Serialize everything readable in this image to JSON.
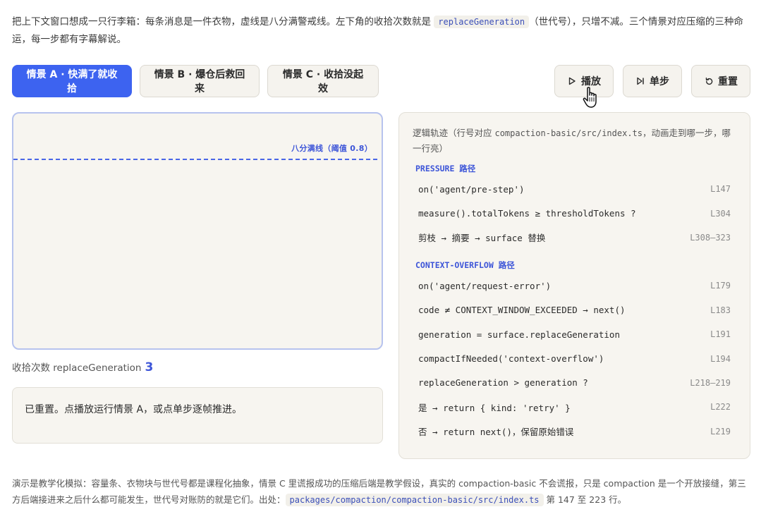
{
  "intro": {
    "text_before": "把上下文窗口想成一只行李箱：每条消息是一件衣物，虚线是八分满警戒线。左下角的收拾次数就是 ",
    "code": "replaceGeneration",
    "text_after": "（世代号），只增不减。三个情景对应压缩的三种命运，每一步都有字幕解说。"
  },
  "scenarios": [
    {
      "label": "情景 A · 快满了就收拾",
      "active": true
    },
    {
      "label": "情景 B · 爆仓后救回来",
      "active": false
    },
    {
      "label": "情景 C · 收拾没起效",
      "active": false
    }
  ],
  "controls": {
    "play": "播放",
    "step": "单步",
    "reset": "重置"
  },
  "stage": {
    "threshold_label": "八分满线（阈值 0.8）"
  },
  "generation": {
    "label": "收拾次数 replaceGeneration",
    "value": "3"
  },
  "caption": "已重置。点播放运行情景 A，或点单步逐帧推进。",
  "trace": {
    "title_before": "逻辑轨迹（行号对应 ",
    "title_code": "compaction-basic/src/index.ts",
    "title_after": "，动画走到哪一步，哪一行亮）",
    "pressure_head": "PRESSURE 路径",
    "pressure_rows": [
      {
        "code": "on('agent/pre-step')",
        "line": "L147"
      },
      {
        "code": "measure().totalTokens ≥ thresholdTokens ?",
        "line": "L304"
      },
      {
        "code": "剪枝 → 摘要 → surface 替换",
        "line": "L308–323"
      }
    ],
    "overflow_head": "CONTEXT-OVERFLOW 路径",
    "overflow_rows": [
      {
        "code": "on('agent/request-error')",
        "line": "L179"
      },
      {
        "code": "code ≠ CONTEXT_WINDOW_EXCEEDED → next()",
        "line": "L183"
      },
      {
        "code": "generation = surface.replaceGeneration",
        "line": "L191"
      },
      {
        "code": "compactIfNeeded('context-overflow')",
        "line": "L194"
      },
      {
        "code": "replaceGeneration > generation ?",
        "line": "L218–219"
      },
      {
        "code": "是 → return { kind: 'retry' }",
        "line": "L222"
      },
      {
        "code": "否 → return next()，保留原始错误",
        "line": "L219"
      }
    ]
  },
  "footer": {
    "text_before": "演示是教学化模拟：容量条、衣物块与世代号都是课程化抽象，情景 C 里谎报成功的压缩后端是教学假设，真实的 compaction-basic 不会谎报，只是 compaction 是一个开放接缝，第三方后端接进来之后什么都可能发生，世代号对账防的就是它们。出处：",
    "code": "packages/compaction/compaction-basic/src/index.ts",
    "text_after": " 第 147 至 223 行。"
  },
  "colors": {
    "accent": "#3d63f0",
    "accent_text": "#3d55d8",
    "panel_bg": "#f7f5f0"
  }
}
